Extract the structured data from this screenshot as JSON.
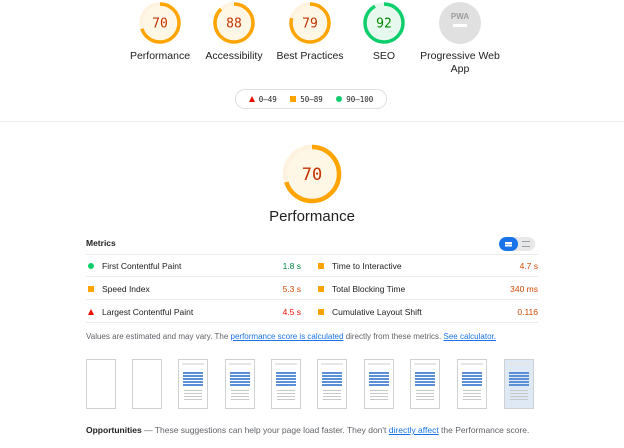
{
  "colors": {
    "pass": "#0cce6b",
    "average": "#ffa400",
    "fail": "#eb0f00",
    "na": "#cccccc",
    "link": "#1a73e8"
  },
  "categories": [
    {
      "score": "70",
      "label": "Performance",
      "fraction": 0.7,
      "status": "average"
    },
    {
      "score": "88",
      "label": "Accessibility",
      "fraction": 0.88,
      "status": "average"
    },
    {
      "score": "79",
      "label": "Best Practices",
      "fraction": 0.79,
      "status": "average"
    },
    {
      "score": "92",
      "label": "SEO",
      "fraction": 0.92,
      "status": "pass"
    },
    {
      "score": "PWA",
      "label": "Progressive Web App",
      "fraction": 0,
      "status": "na"
    }
  ],
  "legend": {
    "fail": "0–49",
    "average": "50–89",
    "pass": "90–100"
  },
  "main": {
    "score": "70",
    "fraction": 0.7,
    "title": "Performance"
  },
  "metrics": {
    "heading": "Metrics",
    "items": [
      {
        "name": "First Contentful Paint",
        "value": "1.8 s",
        "status": "good"
      },
      {
        "name": "Time to Interactive",
        "value": "4.7 s",
        "status": "avg"
      },
      {
        "name": "Speed Index",
        "value": "5.3 s",
        "status": "avg"
      },
      {
        "name": "Total Blocking Time",
        "value": "340 ms",
        "status": "avg"
      },
      {
        "name": "Largest Contentful Paint",
        "value": "4.5 s",
        "status": "bad"
      },
      {
        "name": "Cumulative Layout Shift",
        "value": "0.116",
        "status": "avg"
      }
    ]
  },
  "note": {
    "prefix": "Values are estimated and may vary. The ",
    "link1": "performance score is calculated",
    "middle": " directly from these metrics. ",
    "link2": "See calculator."
  },
  "opportunities": {
    "heading": "Opportunities",
    "text": " — These suggestions can help your page load faster. They don't ",
    "link": "directly affect",
    "suffix": " the Performance score."
  }
}
